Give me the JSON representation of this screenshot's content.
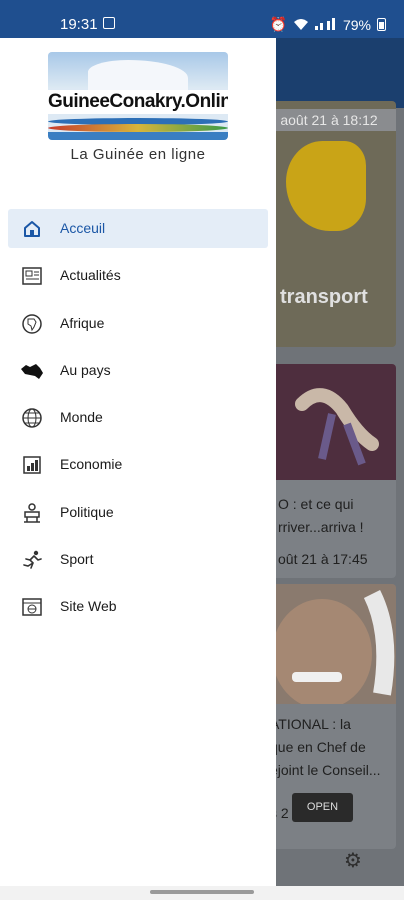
{
  "status_bar": {
    "time": "19:31",
    "battery": "79%"
  },
  "drawer": {
    "logo_text": "GuineeConakry.Online",
    "tagline": "La Guinée en ligne",
    "menu": [
      {
        "label": "Acceuil",
        "icon": "home-icon",
        "active": true
      },
      {
        "label": "Actualités",
        "icon": "newspaper-icon",
        "active": false
      },
      {
        "label": "Afrique",
        "icon": "africa-map-icon",
        "active": false
      },
      {
        "label": "Au pays",
        "icon": "guinea-map-icon",
        "active": false
      },
      {
        "label": "Monde",
        "icon": "globe-icon",
        "active": false
      },
      {
        "label": "Economie",
        "icon": "economy-icon",
        "active": false
      },
      {
        "label": "Politique",
        "icon": "podium-icon",
        "active": false
      },
      {
        "label": "Sport",
        "icon": "runner-icon",
        "active": false
      },
      {
        "label": "Site Web",
        "icon": "website-icon",
        "active": false
      }
    ]
  },
  "background": {
    "card1_date": "août 21 à 18:12",
    "card1_title": "transport",
    "card2_lines": [
      "O : et ce qui",
      "rriver...arriva !",
      "oût 21 à 17:45"
    ],
    "card3_lines": [
      "ATIONAL : la",
      "que en Chef de",
      "ejoint le Conseil...",
      "s 2"
    ],
    "open_button": "OPEN"
  },
  "colors": {
    "accent": "#1b57a6",
    "status_bar": "#1f4f8f",
    "active_bg": "#e4edf7"
  }
}
